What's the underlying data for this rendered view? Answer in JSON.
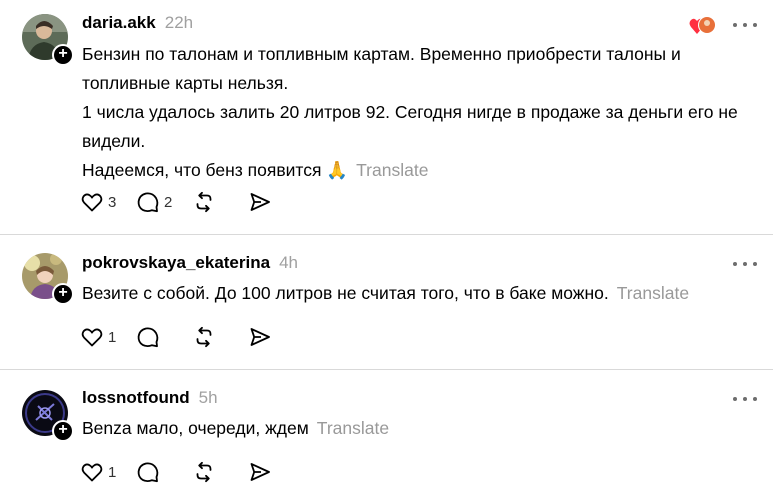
{
  "posts": [
    {
      "username": "daria.akk",
      "time": "22h",
      "lines": [
        "Бензин по талонам и топливным картам. Временно приобрести талоны и топливные карты нельзя.",
        "1 числа удалось залить 20 литров 92. Сегодня нигде в продаже за деньги его не видели.",
        "Надеемся, что бенз появится 🙏"
      ],
      "translate": "Translate",
      "likes": "3",
      "replies": "2",
      "reposts": "",
      "shares": ""
    },
    {
      "username": "pokrovskaya_ekaterina",
      "time": "4h",
      "lines": [
        "Везите с собой. До 100 литров не считая того, что в баке можно."
      ],
      "translate": "Translate",
      "likes": "1",
      "replies": "",
      "reposts": "",
      "shares": ""
    },
    {
      "username": "lossnotfound",
      "time": "5h",
      "lines": [
        "Benza мало, очереди, ждем"
      ],
      "translate": "Translate",
      "likes": "1",
      "replies": "",
      "reposts": "",
      "shares": ""
    }
  ],
  "icons": {
    "follow": "plus-icon",
    "more": "more-horizontal-icon",
    "like": "heart-icon",
    "reply": "comment-icon",
    "repost": "repost-icon",
    "share": "send-icon"
  },
  "colors": {
    "text": "#000000",
    "muted": "#999999",
    "divider": "#d9d9d9",
    "liked": "#ff3040"
  }
}
